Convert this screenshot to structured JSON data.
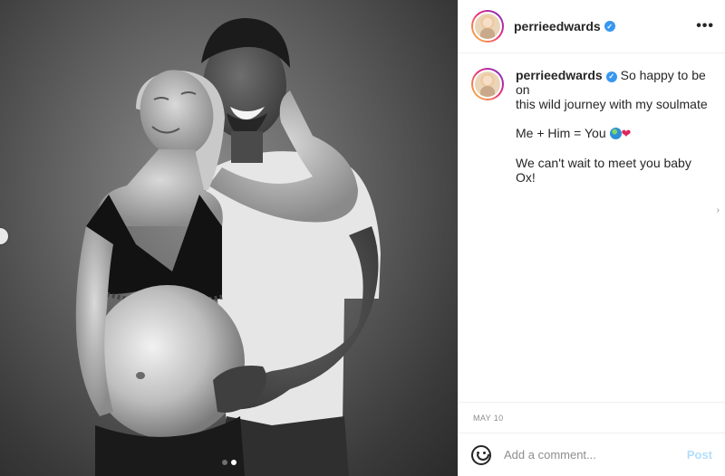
{
  "header": {
    "username": "perrieedwards",
    "more_label": "•••"
  },
  "caption": {
    "username": "perrieedwards",
    "line1": "So happy to be on",
    "line2": "this wild journey with my soulmate",
    "line3": "Me + Him = You",
    "line4": "We can't wait to meet you baby Ox!"
  },
  "scroll_hint": "›",
  "date": "MAY 10",
  "comment_box": {
    "placeholder": "Add a comment...",
    "post_label": "Post"
  },
  "carousel": {
    "slide_count": 2,
    "active_index": 1
  },
  "colors": {
    "verified": "#3897f0",
    "post_button": "#b2dffc",
    "border": "#efefef",
    "muted": "#8e8e8e"
  },
  "icons": [
    "verified-badge-icon",
    "more-options-icon",
    "emoji-smile-icon",
    "globe-emoji",
    "heart-emoji",
    "prev-arrow-icon"
  ]
}
